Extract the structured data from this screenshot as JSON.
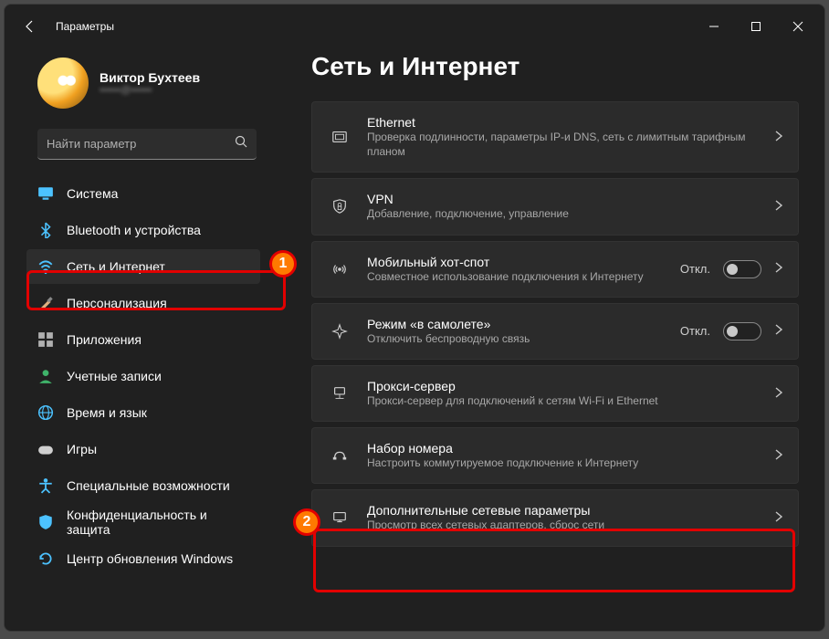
{
  "titlebar": {
    "title": "Параметры"
  },
  "profile": {
    "name": "Виктор Бухтеев",
    "sub": "••••••@••••••"
  },
  "search": {
    "placeholder": "Найти параметр"
  },
  "sidebar": {
    "items": [
      {
        "label": "Система",
        "icon": "display-icon",
        "color": "#4cc2ff"
      },
      {
        "label": "Bluetooth и устройства",
        "icon": "bluetooth-icon",
        "color": "#4cc2ff"
      },
      {
        "label": "Сеть и Интернет",
        "icon": "wifi-icon",
        "color": "#4cc2ff",
        "selected": true
      },
      {
        "label": "Персонализация",
        "icon": "brush-icon",
        "color": "#e0b080"
      },
      {
        "label": "Приложения",
        "icon": "apps-icon",
        "color": "#b0b0b0"
      },
      {
        "label": "Учетные записи",
        "icon": "person-icon",
        "color": "#3fb36a"
      },
      {
        "label": "Время и язык",
        "icon": "globe-icon",
        "color": "#4cc2ff"
      },
      {
        "label": "Игры",
        "icon": "gamepad-icon",
        "color": "#d0d0d0"
      },
      {
        "label": "Специальные возможности",
        "icon": "accessibility-icon",
        "color": "#4cc2ff"
      },
      {
        "label": "Конфиденциальность и защита",
        "icon": "shield-icon",
        "color": "#4cc2ff"
      },
      {
        "label": "Центр обновления Windows",
        "icon": "update-icon",
        "color": "#4cc2ff"
      }
    ]
  },
  "page": {
    "title": "Сеть и Интернет"
  },
  "cards": [
    {
      "icon": "ethernet-icon",
      "title": "Ethernet",
      "desc": "Проверка подлинности, параметры IP-и DNS, сеть с лимитным тарифным планом"
    },
    {
      "icon": "vpn-icon",
      "title": "VPN",
      "desc": "Добавление, подключение, управление"
    },
    {
      "icon": "hotspot-icon",
      "title": "Мобильный хот-спот",
      "desc": "Совместное использование подключения к Интернету",
      "toggle": true,
      "state": "Откл."
    },
    {
      "icon": "airplane-icon",
      "title": "Режим «в самолете»",
      "desc": "Отключить беспроводную связь",
      "toggle": true,
      "state": "Откл."
    },
    {
      "icon": "proxy-icon",
      "title": "Прокси-сервер",
      "desc": "Прокси-сервер для подключений к сетям Wi-Fi и Ethernet"
    },
    {
      "icon": "dialup-icon",
      "title": "Набор номера",
      "desc": "Настроить коммутируемое подключение к Интернету"
    },
    {
      "icon": "advanced-icon",
      "title": "Дополнительные сетевые параметры",
      "desc": "Просмотр всех сетевых адаптеров, сброс сети"
    }
  ],
  "annotations": {
    "one": "1",
    "two": "2"
  }
}
